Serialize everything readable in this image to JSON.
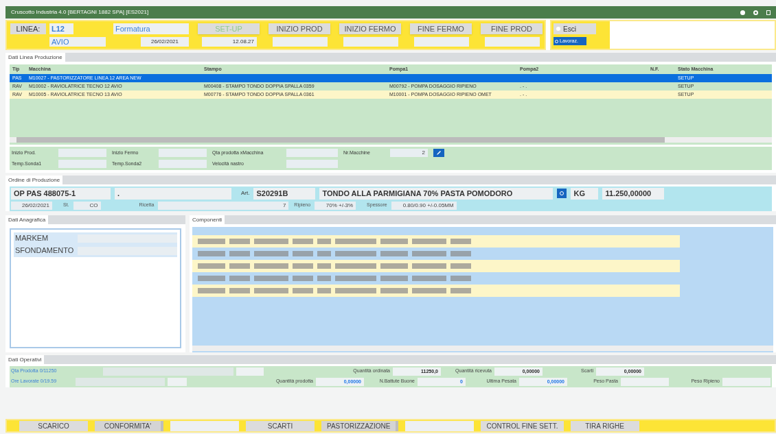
{
  "window": {
    "title": "Cruscotto Industria 4.0 [BERTAGNI 1882 SPA] [ES2021]"
  },
  "header": {
    "linea_label": "LINEA:",
    "linea": "L12",
    "area": "AVIO",
    "phase": "Formatura",
    "date": "26/02/2021",
    "time": "12.08.27",
    "steps": [
      {
        "label": "SET-UP",
        "active": true
      },
      {
        "label": "INIZIO PROD",
        "active": false
      },
      {
        "label": "INIZIO FERMO",
        "active": false
      },
      {
        "label": "FINE FERMO",
        "active": false
      },
      {
        "label": "FINE PROD",
        "active": false
      }
    ],
    "exit_button": "Esci",
    "work_button": "Lavoraz."
  },
  "line_panel": {
    "tab": "Dati Linea Produzione",
    "columns": [
      "Tip",
      "Macchina",
      "Stampo",
      "Pompa1",
      "Pompa2",
      "N.F.",
      "Stato Macchina"
    ],
    "rows": [
      {
        "selected": true,
        "cells": [
          "PAS",
          "M10027 - PASTORIZZATORE LINEA 12 AREA NEW",
          null,
          null,
          null,
          null,
          "SETUP"
        ]
      },
      {
        "selected": false,
        "highlight": false,
        "cells": [
          "RAV",
          "M10002 - RAVIOLATRICE TECNO 12 AVIO",
          "M00408 - STAMPO TONDO DOPPIA SPALLA 0359",
          "M00792 - POMPA DOSAGGIO RIPIENO",
          ". - .",
          null,
          "SETUP"
        ]
      },
      {
        "selected": false,
        "highlight": true,
        "cells": [
          "RAV",
          "M10005 - RAVIOLATRICE TECNO 13 AVIO",
          "M00776 - STAMPO TONDO DOPPIA SPALLA 0361",
          "M10001 - POMPA DOSAGGIO RIPIENO OMET",
          ". - .",
          null,
          "SETUP"
        ]
      }
    ],
    "fields": [
      {
        "label": "Inizio Prod."
      },
      {
        "label": "Inizio Fermo"
      },
      {
        "label": "Qta prodotta xMacchina"
      },
      {
        "label": "Nr.Macchine",
        "value": "2"
      },
      {
        "label": "Temp.Sonda1"
      },
      {
        "label": "Temp.Sonda2"
      },
      {
        "label": "Velocità nastro"
      }
    ]
  },
  "order": {
    "tab": "Ordine di Produzione",
    "code": "OP PAS 488075-1",
    "dot": ".",
    "art_label": "Art.",
    "article": "S20291B",
    "description": "TONDO ALLA PARMIGIANA 70% PASTA POMODORO",
    "unit": "KG",
    "quantity": "11.250,00000",
    "date": "26/02/2021",
    "st_label": "St.",
    "st": "CO",
    "recipe_label": "Ricetta",
    "recipe": "7",
    "filling_label": "Ripieno",
    "filling": "70% +/-3%",
    "thickness_label": "Spessore",
    "thickness": "0.80/0.90 +/-0.05MM"
  },
  "registry": {
    "tab": "Dati Anagrafica",
    "items": [
      {
        "label": "MARKEM"
      },
      {
        "label": "SFONDAMENTO"
      }
    ]
  },
  "components": {
    "tab": "Componenti",
    "rows": [
      {
        "kind": "blurred"
      },
      {
        "kind": "blurred"
      },
      {
        "kind": "blurred"
      },
      {
        "kind": "blurred"
      },
      {
        "kind": "blurred"
      }
    ]
  },
  "operations": {
    "tab": "Dati Operativi",
    "progress": [
      {
        "label": "Qta Prodotta 0/11250",
        "level": 0
      },
      {
        "label": "Ore Lavorate 0/19.59",
        "level": 0
      }
    ],
    "stats": [
      [
        {
          "label": "Quantità ordinata",
          "value": "11250,0",
          "blue": false
        },
        {
          "label": "Quantità ricevuta",
          "value": "0,00000",
          "blue": false
        },
        {
          "label": "Scarti",
          "value": "0,00000",
          "blue": false
        }
      ],
      [
        {
          "label": "Quantità prodotta",
          "value": "0,00000",
          "blue": true
        },
        {
          "label": "N.Battute Buone",
          "value": "0",
          "blue": true
        },
        {
          "label": "Ultima Pesata",
          "value": "0,00000",
          "blue": true
        },
        {
          "label": "Peso Pasta"
        },
        {
          "label": "Peso Ripieno"
        }
      ]
    ]
  },
  "bottom_buttons": [
    {
      "label": "SCARICO",
      "has_field": false
    },
    {
      "label": "CONFORMITA'",
      "has_field": true
    },
    {
      "label": "SCARTI",
      "has_field": false
    },
    {
      "label": "PASTORIZZAZIONE",
      "has_field": true
    },
    {
      "label": "CONTROL FINE SETT.",
      "has_field": false
    },
    {
      "label": "TIRA RIGHE",
      "has_field": false
    }
  ]
}
